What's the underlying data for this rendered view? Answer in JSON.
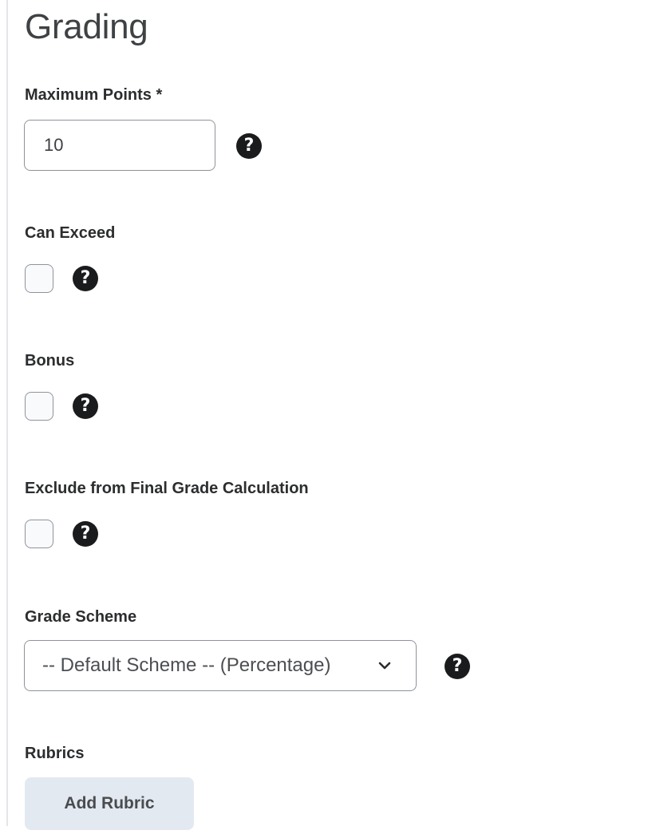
{
  "section": {
    "title": "Grading"
  },
  "maximum_points": {
    "label": "Maximum Points *",
    "value": "10",
    "help_icon": "question-circle-icon"
  },
  "can_exceed": {
    "label": "Can Exceed",
    "checked": false,
    "help_icon": "question-circle-icon"
  },
  "bonus": {
    "label": "Bonus",
    "checked": false,
    "help_icon": "question-circle-icon"
  },
  "exclude_final_grade": {
    "label": "Exclude from Final Grade Calculation",
    "checked": false,
    "help_icon": "question-circle-icon"
  },
  "grade_scheme": {
    "label": "Grade Scheme",
    "selected": "-- Default Scheme -- (Percentage)",
    "help_icon": "question-circle-icon",
    "chevron_icon": "chevron-down-icon"
  },
  "rubrics": {
    "label": "Rubrics",
    "add_button_label": "Add Rubric"
  }
}
